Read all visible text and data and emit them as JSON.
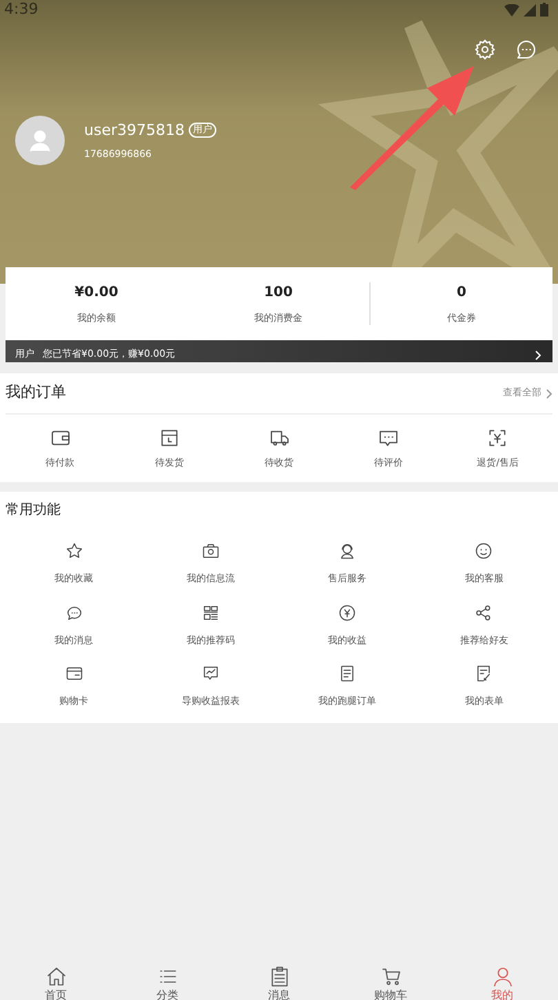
{
  "status_bar": {
    "time": "4:39"
  },
  "profile": {
    "username": "user3975818",
    "badge": "用户",
    "phone": "17686996866"
  },
  "stats": [
    {
      "value": "¥0.00",
      "label": "我的余额"
    },
    {
      "value": "100",
      "label": "我的消费金"
    },
    {
      "value": "0",
      "label": "代金券"
    }
  ],
  "savings_bar": {
    "label": "用户",
    "text": "您已节省¥0.00元，赚¥0.00元"
  },
  "orders": {
    "title": "我的订单",
    "view_all": "查看全部",
    "items": [
      {
        "label": "待付款"
      },
      {
        "label": "待发货"
      },
      {
        "label": "待收货"
      },
      {
        "label": "待评价"
      },
      {
        "label": "退货/售后"
      }
    ]
  },
  "functions": {
    "title": "常用功能",
    "items": [
      {
        "label": "我的收藏"
      },
      {
        "label": "我的信息流"
      },
      {
        "label": "售后服务"
      },
      {
        "label": "我的客服"
      },
      {
        "label": "我的消息"
      },
      {
        "label": "我的推荐码"
      },
      {
        "label": "我的收益"
      },
      {
        "label": "推荐给好友"
      },
      {
        "label": "购物卡"
      },
      {
        "label": "导购收益报表"
      },
      {
        "label": "我的跑腿订单"
      },
      {
        "label": "我的表单"
      }
    ]
  },
  "bottom_nav": [
    {
      "label": "首页",
      "selected": false
    },
    {
      "label": "分类",
      "selected": false
    },
    {
      "label": "消息",
      "selected": false
    },
    {
      "label": "购物车",
      "selected": false
    },
    {
      "label": "我的",
      "selected": true
    }
  ]
}
